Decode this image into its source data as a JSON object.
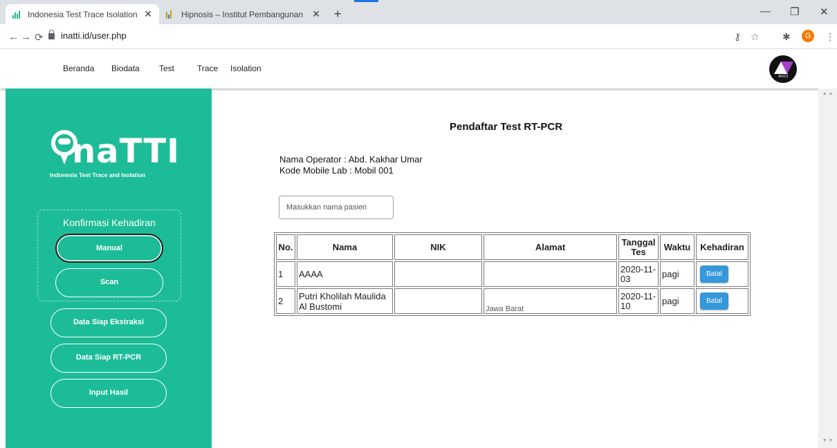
{
  "browser": {
    "tabs": [
      {
        "title": "Indonesia Test Trace Isolation",
        "active": true
      },
      {
        "title": "Hipnosis – Institut Pembangunan",
        "active": false
      }
    ],
    "url": "inatti.id/user.php",
    "profile_initial": "G"
  },
  "nav": {
    "links": [
      "Beranda",
      "Biodata",
      "Test",
      "Trace",
      "Isolation"
    ],
    "brand_logo_text": "AVICII"
  },
  "sidebar": {
    "logo_word": "naTTI",
    "logo_tagline": "Indonesia Test Trace and Isolation",
    "confirm_title": "Konfirmasi Kehadiran",
    "confirm_buttons": [
      "Manual",
      "Scan"
    ],
    "menu": [
      "Data Siap Ekstraksi",
      "Data Siap RT-PCR",
      "Input Hasil"
    ]
  },
  "main": {
    "title": "Pendaftar Test RT-PCR",
    "operator": "Nama Operator : Abd. Kakhar Umar",
    "mobile_lab": "Kode Mobile Lab : Mobil 001",
    "search_placeholder": "Masukkan nama pasien",
    "table": {
      "headers": [
        "No.",
        "Nama",
        "NIK",
        "Alamat",
        "Tanggal Tes",
        "Waktu",
        "Kehadiran"
      ],
      "rows": [
        {
          "no": "1",
          "nama": "AAAA",
          "nik": "",
          "alamat": "",
          "tanggal": "2020-11-03",
          "waktu": "pagi",
          "action": "Batal"
        },
        {
          "no": "2",
          "nama": "Putri Kholilah Maulida Al Bustomi",
          "nik": "",
          "alamat": "Jawa Barat",
          "tanggal": "2020-11-10",
          "waktu": "pagi",
          "action": "Batal"
        }
      ]
    }
  },
  "colors": {
    "sidebar": "#1dbc98",
    "button_batal": "#3498db"
  }
}
